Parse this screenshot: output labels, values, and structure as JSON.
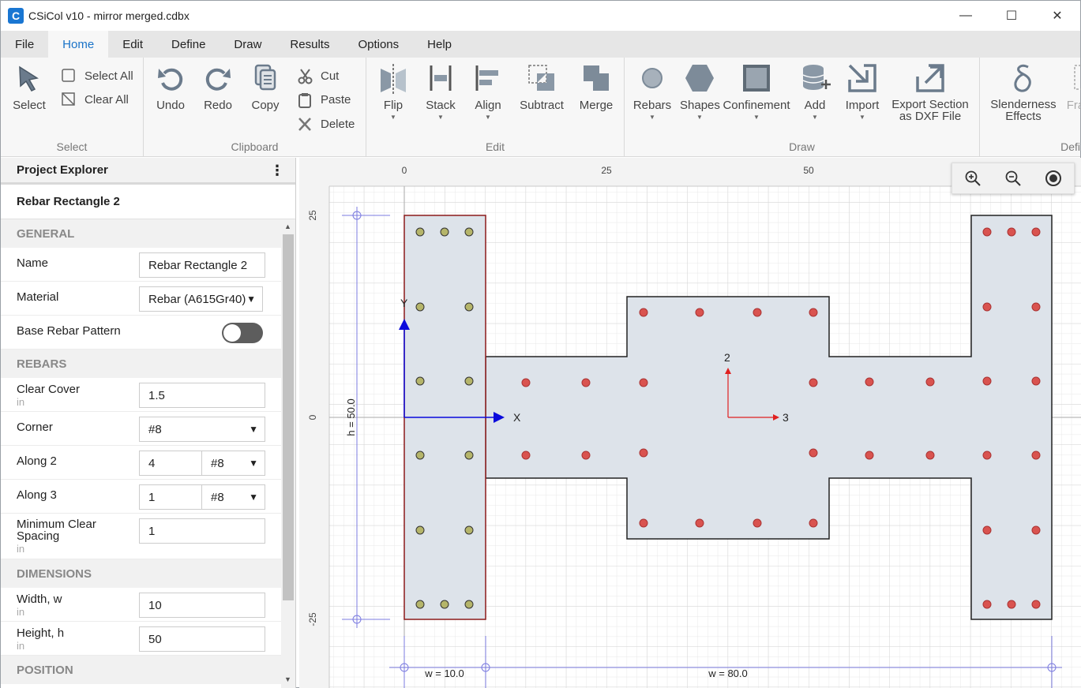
{
  "window": {
    "app_logo": "C",
    "title": "CSiCol v10 - mirror merged.cdbx",
    "controls": [
      "—",
      "☐",
      "✕"
    ]
  },
  "menu": [
    "File",
    "Home",
    "Edit",
    "Define",
    "Draw",
    "Results",
    "Options",
    "Help"
  ],
  "ribbon": {
    "select_group": {
      "label": "Select",
      "select": "Select",
      "select_all": "Select All",
      "clear_all": "Clear All"
    },
    "clipboard_group": {
      "label": "Clipboard",
      "undo": "Undo",
      "redo": "Redo",
      "copy": "Copy",
      "cut": "Cut",
      "paste": "Paste",
      "delete": "Delete"
    },
    "edit_group": {
      "label": "Edit",
      "flip": "Flip",
      "stack": "Stack",
      "align": "Align",
      "subtract": "Subtract",
      "merge": "Merge"
    },
    "draw_group": {
      "label": "Draw",
      "rebars": "Rebars",
      "shapes": "Shapes",
      "confinement": "Confinement",
      "add": "Add",
      "import": "Import",
      "export_line1": "Export Section",
      "export_line2": "as DXF File"
    },
    "define_group": {
      "label": "Defi",
      "slenderness_line1": "Slenderness",
      "slenderness_line2": "Effects",
      "frame_partial": "Fra"
    }
  },
  "panel": {
    "header": "Project Explorer",
    "menu_glyph": "⋮",
    "object_title": "Rebar Rectangle 2",
    "sections": {
      "general": "GENERAL",
      "rebars": "REBARS",
      "dimensions": "DIMENSIONS",
      "position": "POSITION"
    },
    "name_label": "Name",
    "name_value": "Rebar Rectangle 2",
    "material_label": "Material",
    "material_value": "Rebar (A615Gr40)",
    "base_pattern_label": "Base Rebar Pattern",
    "clear_cover_label": "Clear Cover",
    "clear_cover_unit": "in",
    "clear_cover_value": "1.5",
    "corner_label": "Corner",
    "corner_value": "#8",
    "along2_label": "Along 2",
    "along2_count": "4",
    "along2_size": "#8",
    "along3_label": "Along 3",
    "along3_count": "1",
    "along3_size": "#8",
    "min_spacing_label_1": "Minimum Clear",
    "min_spacing_label_2": "Spacing",
    "min_spacing_unit": "in",
    "min_spacing_value": "1",
    "width_label": "Width, w",
    "width_unit": "in",
    "width_value": "10",
    "height_label": "Height, h",
    "height_unit": "in",
    "height_value": "50"
  },
  "canvas": {
    "x_ticks": [
      "0",
      "25",
      "50"
    ],
    "y_ticks": [
      "25",
      "0",
      "-25"
    ],
    "axis_x_label": "X",
    "axis_y_label": "Y",
    "local_2_label": "2",
    "local_3_label": "3",
    "dim_h": "h = 50.0",
    "dim_w1": "w = 10.0",
    "dim_w2": "w = 80.0",
    "colors": {
      "section_fill": "#dde3ea",
      "selected_outline": "#8b1a1a",
      "rebar_selected": "#b5b56a",
      "rebar": "#d9534f",
      "axis_global": "#0a0adc",
      "axis_local": "#e02020"
    }
  },
  "zoom": {
    "zoom_in": "zoom-in-icon",
    "zoom_out": "zoom-out-icon",
    "fit": "fit-view-icon"
  }
}
